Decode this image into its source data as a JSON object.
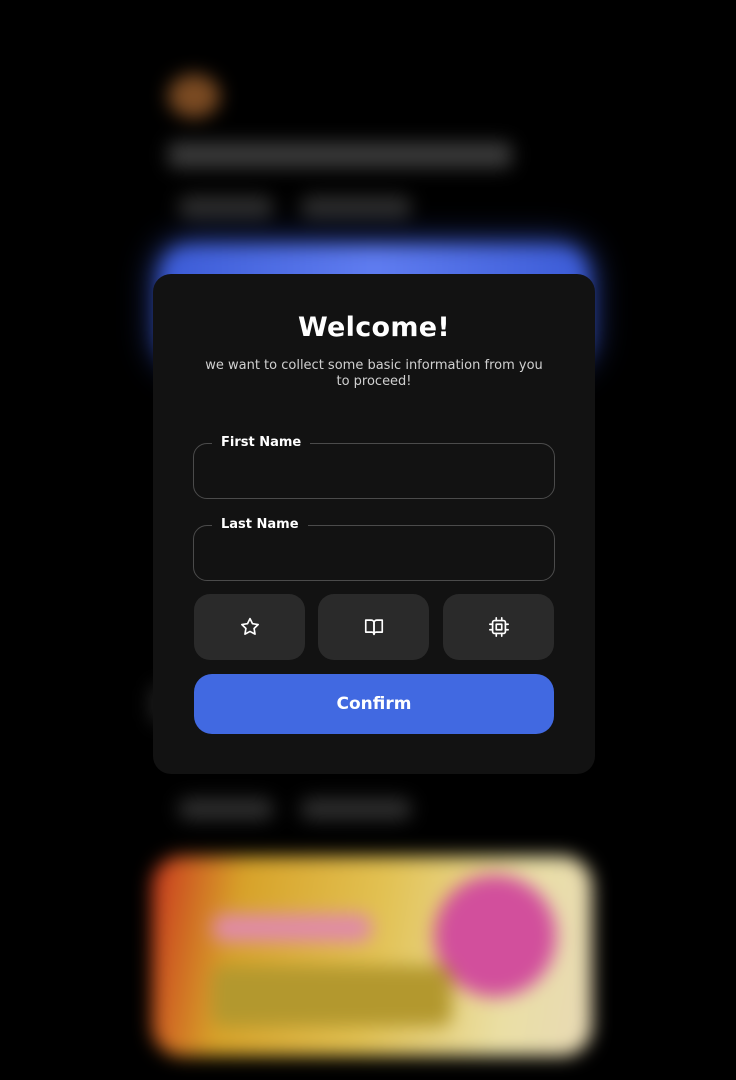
{
  "modal": {
    "title": "Welcome!",
    "subtitle": "we want to collect some basic information from you to proceed!",
    "fields": [
      {
        "label": "First Name",
        "value": "",
        "placeholder": ""
      },
      {
        "label": "Last Name",
        "value": "",
        "placeholder": ""
      }
    ],
    "options": [
      {
        "icon": "star-icon"
      },
      {
        "icon": "book-icon"
      },
      {
        "icon": "chip-icon"
      }
    ],
    "confirm_label": "Confirm"
  },
  "colors": {
    "background": "#000000",
    "modal": "#121212",
    "accent": "#4169e1",
    "option_button": "#2a2a2a"
  }
}
